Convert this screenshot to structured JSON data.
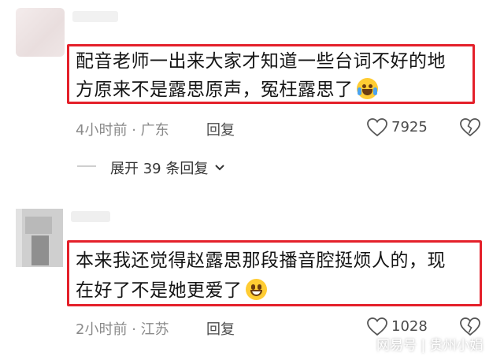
{
  "comments": [
    {
      "text_line1": "配音老师一出来大家才知道一些台词不好的地",
      "text_line2": "方原来不是露思原声，冤枉露思了",
      "emoji": "crying-laughing-emoji",
      "time": "4小时前",
      "location": "广东",
      "reply_label": "回复",
      "likes": "7925"
    },
    {
      "text_line1": "本来我还觉得赵露思那段播音腔挺烦人的，现",
      "text_line2": "在好了不是她更爱了",
      "emoji": "grinning-emoji",
      "time": "2小时前",
      "location": "江苏",
      "reply_label": "回复",
      "likes": "1028"
    }
  ],
  "expand_replies": "展开 39 条回复",
  "watermark": {
    "platform": "网易号",
    "separator": "|",
    "author": "贵州小娟"
  },
  "colors": {
    "highlight_border": "#e4202a",
    "meta_text": "#8a8a8a"
  }
}
